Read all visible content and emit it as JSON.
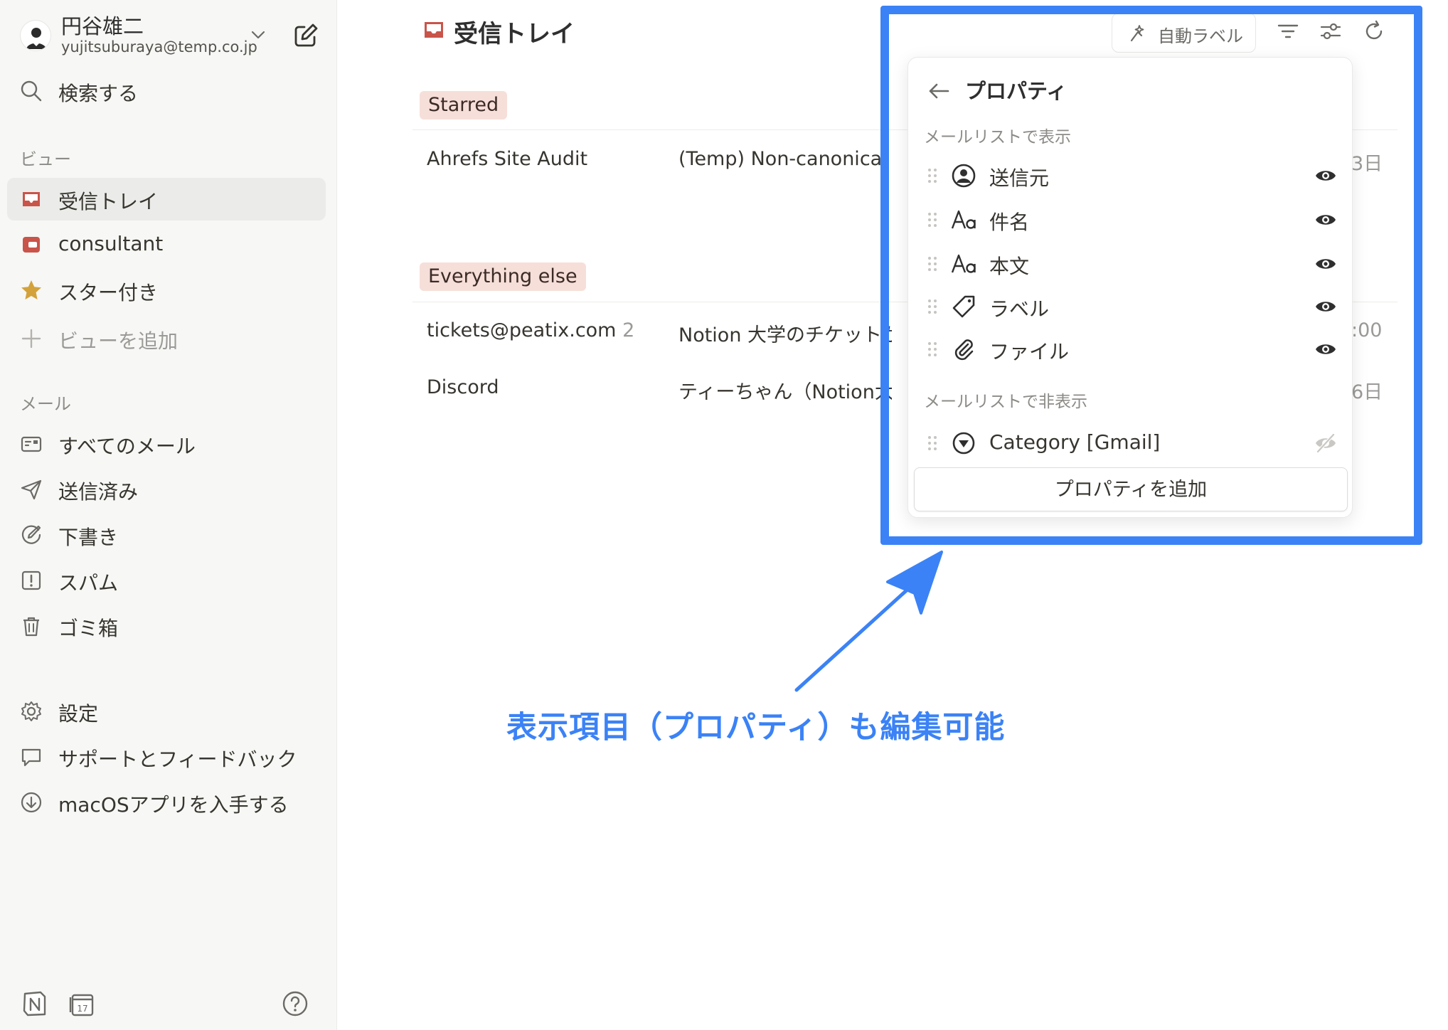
{
  "sidebar": {
    "account": {
      "name": "円谷雄二",
      "email": "yujitsuburaya@temp.co.jp"
    },
    "search_label": "検索する",
    "views_title": "ビュー",
    "views": [
      {
        "label": "受信トレイ",
        "icon": "inbox-icon",
        "active": true
      },
      {
        "label": "consultant",
        "icon": "consultant-view-icon"
      },
      {
        "label": "スター付き",
        "icon": "star-icon"
      }
    ],
    "add_view_label": "ビューを追加",
    "mail_title": "メール",
    "mail_items": [
      {
        "label": "すべてのメール",
        "icon": "all-mail-icon"
      },
      {
        "label": "送信済み",
        "icon": "send-icon"
      },
      {
        "label": "下書き",
        "icon": "draft-icon"
      },
      {
        "label": "スパム",
        "icon": "spam-icon"
      },
      {
        "label": "ゴミ箱",
        "icon": "trash-icon"
      }
    ],
    "footer_items": [
      {
        "label": "設定",
        "icon": "gear-icon"
      },
      {
        "label": "サポートとフィードバック",
        "icon": "feedback-icon"
      },
      {
        "label": "macOSアプリを入手する",
        "icon": "download-icon"
      }
    ]
  },
  "main": {
    "title": "受信トレイ",
    "groups": [
      {
        "name": "Starred",
        "rows": [
          {
            "from": "Ahrefs Site Audit",
            "count": "",
            "subject": "(Temp) Non-canonical pa",
            "date": "3日"
          }
        ]
      },
      {
        "name": "Everything else",
        "rows": [
          {
            "from": "tickets@peatix.com",
            "count": "2",
            "subject": "Notion 大学のチケットが",
            "date": ":00"
          },
          {
            "from": "Discord",
            "count": "",
            "subject": "ティーちゃん（Notion大学",
            "date": "6日"
          }
        ]
      }
    ],
    "toolbar": {
      "auto_label": "自動ラベル"
    }
  },
  "popup": {
    "title": "プロパティ",
    "shown_title": "メールリストで表示",
    "shown": [
      {
        "label": "送信元",
        "icon": "person-icon"
      },
      {
        "label": "件名",
        "icon": "text-aa-icon"
      },
      {
        "label": "本文",
        "icon": "text-aa-icon"
      },
      {
        "label": "ラベル",
        "icon": "tag-icon"
      },
      {
        "label": "ファイル",
        "icon": "paperclip-icon"
      }
    ],
    "hidden_title": "メールリストで非表示",
    "hidden": [
      {
        "label": "Category [Gmail]",
        "icon": "select-icon"
      }
    ],
    "add_label": "プロパティを追加"
  },
  "annotation": {
    "text": "表示項目（プロパティ）も編集可能",
    "color": "#3b82f6"
  },
  "colors": {
    "accent": "#3b82f6",
    "inbox_red": "#c9544a",
    "tag_bg": "#f7dfd9"
  }
}
